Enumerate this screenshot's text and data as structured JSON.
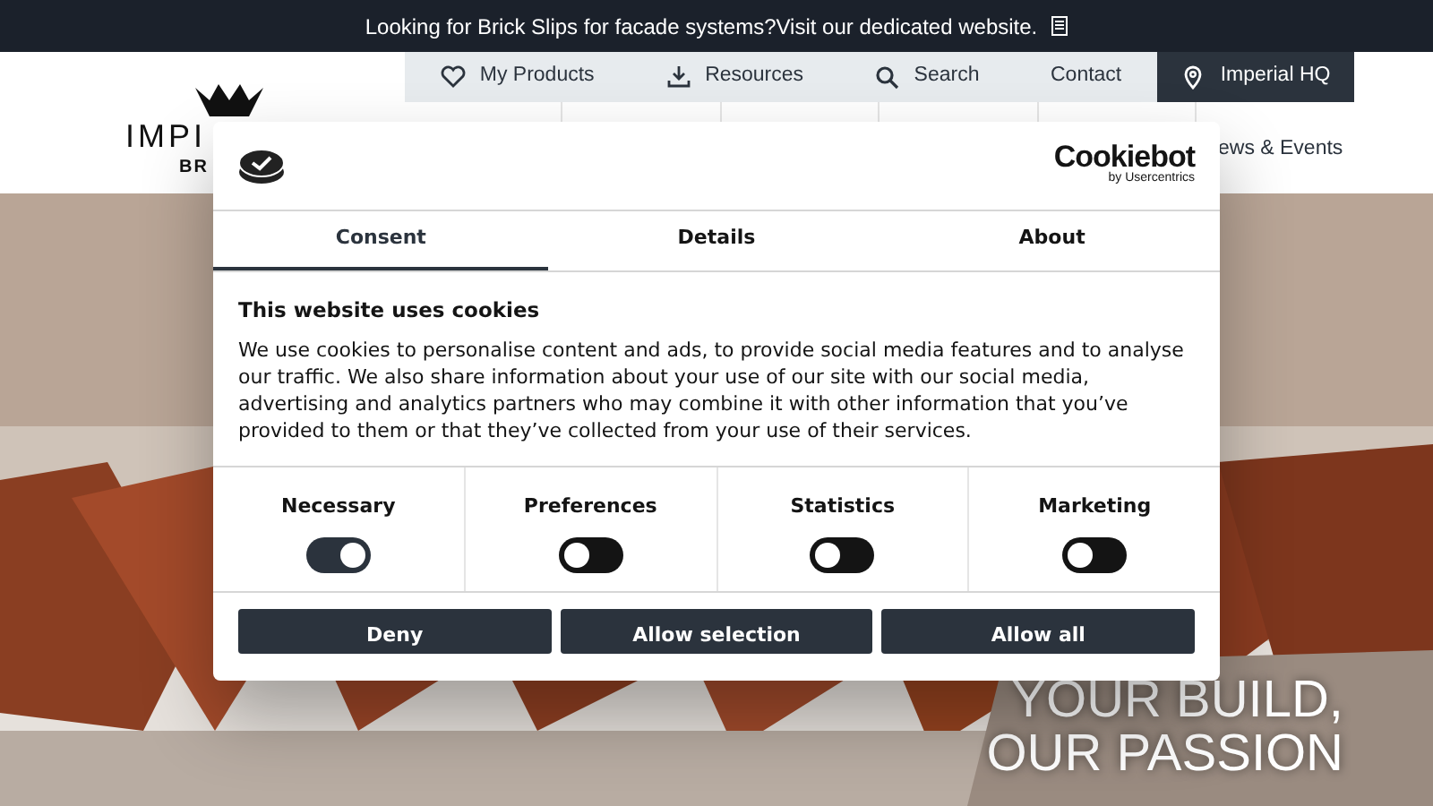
{
  "announcement": {
    "text": "Looking for Brick Slips for facade systems?Visit our dedicated website."
  },
  "top_nav": [
    {
      "label": "My Products",
      "kind": "link"
    },
    {
      "label": "Resources",
      "kind": "link"
    },
    {
      "label": "Search",
      "kind": "link"
    },
    {
      "label": "Contact",
      "kind": "link"
    },
    {
      "label": "Imperial HQ",
      "kind": "location"
    }
  ],
  "logo": {
    "line_1": "IMPI",
    "line_2": "BR"
  },
  "main_nav_partial": "ews & Events",
  "hero": {
    "headline": [
      "YOUR BUILD,",
      "OUR PASSION"
    ]
  },
  "cookie_dialog": {
    "brand": "Cookiebot",
    "brand_sub": "by Usercentrics",
    "tabs": [
      {
        "label": "Consent",
        "selected": true
      },
      {
        "label": "Details",
        "selected": false
      },
      {
        "label": "About",
        "selected": false
      }
    ],
    "title": "This website uses cookies",
    "body": "We use cookies to personalise content and ads, to provide social media features and to analyse our traffic. We also share information about your use of our site with our social media, advertising and analytics partners who may combine it with other information that you’ve provided to them or that they’ve collected from your use of their services.",
    "toggles": [
      {
        "label": "Necessary",
        "on": true
      },
      {
        "label": "Preferences",
        "on": false
      },
      {
        "label": "Statistics",
        "on": false
      },
      {
        "label": "Marketing",
        "on": false
      }
    ],
    "buttons": [
      "Deny",
      "Allow selection",
      "Allow all"
    ]
  }
}
